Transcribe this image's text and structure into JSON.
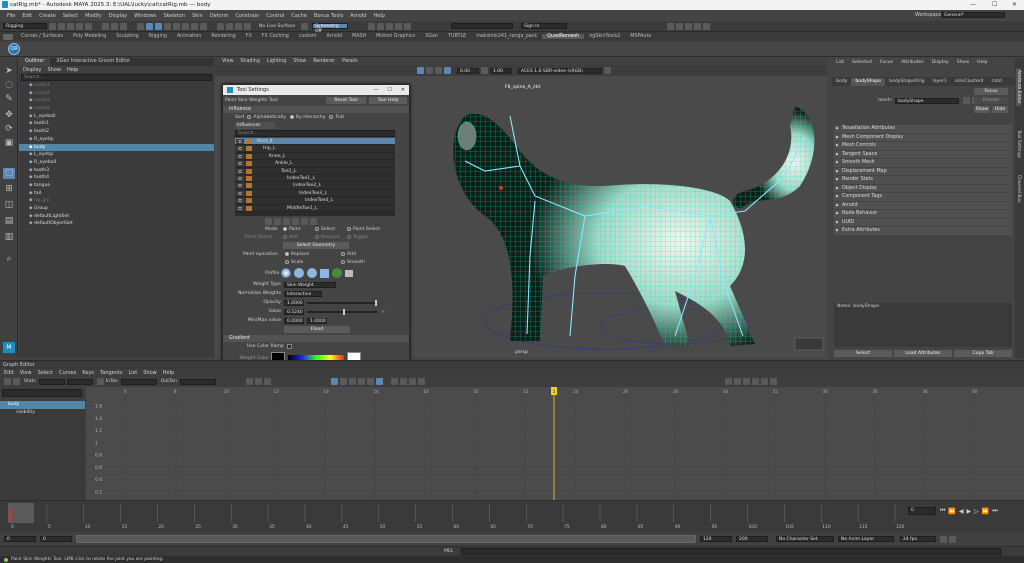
{
  "window": {
    "title": "catRig.mb* - Autodesk MAYA 2025.3: E:\\UAL\\lucky\\cat\\catRig.mb   ---   body",
    "workspace_label": "Workspace :",
    "workspace_value": "General*"
  },
  "menus": [
    "File",
    "Edit",
    "Create",
    "Select",
    "Modify",
    "Display",
    "Windows",
    "Skeleton",
    "Skin",
    "Deform",
    "Constrain",
    "Control",
    "Cache",
    "Bonus Tools",
    "Arnold",
    "Help"
  ],
  "status_line": {
    "mode": "Rigging",
    "live_surface": "No Live Surface",
    "symmetry": "Symmetry: Off",
    "sign_in": "Sign In"
  },
  "shelf_tabs": [
    "Curves / Surfaces",
    "Poly Modeling",
    "Sculpting",
    "Rigging",
    "Animation",
    "Rendering",
    "FX",
    "FX Caching",
    "custom",
    "Arnold",
    "MASH",
    "Motion Graphics",
    "XGen",
    "TURTLE",
    "maksimk241_ranga_pack",
    "QuadRemesh",
    "ngSkinTools2",
    "MSPAuto"
  ],
  "shelf_active": "QuadRemesh",
  "outliner": {
    "tabs": [
      "Outliner",
      "XGen Interactive Groom Editor"
    ],
    "menu": [
      "Display",
      "Show",
      "Help"
    ],
    "search_placeholder": "Search...",
    "items": [
      {
        "name": "nurbs1",
        "style": "dim"
      },
      {
        "name": "nurbs2",
        "style": "dim"
      },
      {
        "name": "nurbs3",
        "style": "dim"
      },
      {
        "name": "nurbs4",
        "style": "dim"
      },
      {
        "name": "L_eyeball",
        "style": ""
      },
      {
        "name": "tooth1",
        "style": ""
      },
      {
        "name": "tooth2",
        "style": ""
      },
      {
        "name": "R_eyetip",
        "style": ""
      },
      {
        "name": "body",
        "style": "sel"
      },
      {
        "name": "L_eyetip",
        "style": ""
      },
      {
        "name": "R_eyeball",
        "style": ""
      },
      {
        "name": "tooth3",
        "style": ""
      },
      {
        "name": "tooth4",
        "style": ""
      },
      {
        "name": "tongue",
        "style": ""
      },
      {
        "name": "tail",
        "style": ""
      },
      {
        "name": "rig_grp",
        "style": "dim"
      },
      {
        "name": "Group",
        "style": ""
      },
      {
        "name": "defaultLightSet",
        "style": ""
      },
      {
        "name": "defaultObjectSet",
        "style": ""
      }
    ]
  },
  "viewport": {
    "menu": [
      "View",
      "Shading",
      "Lighting",
      "Show",
      "Renderer",
      "Panels"
    ],
    "field_a": "0.00",
    "field_b": "1.00",
    "colorspace": "ACES 1.0 SDR-video (sRGB)",
    "cam_label": "persp",
    "joint_label": "FK_spine_A_ctrl"
  },
  "tool_settings": {
    "window_title": "Tool Settings",
    "tool_name": "Paint Skin Weights Tool",
    "reset_label": "Reset Tool",
    "help_label": "Tool Help",
    "section_influence": "Influence",
    "sort_label": "Sort",
    "sort_options": [
      "Alphabetically",
      "By Hierarchy",
      "Flat"
    ],
    "influences_label": "Influences",
    "search_placeholder": "Search...",
    "joints": [
      {
        "name": "Root_Jt",
        "indent": 0,
        "sel": true
      },
      {
        "name": "Hip_L",
        "indent": 1,
        "sel": false
      },
      {
        "name": "Knee_L",
        "indent": 2,
        "sel": false
      },
      {
        "name": "Ankle_L",
        "indent": 3,
        "sel": false
      },
      {
        "name": "Toe1_L",
        "indent": 4,
        "sel": false
      },
      {
        "name": "IndexToe1_L",
        "indent": 5,
        "sel": false
      },
      {
        "name": "IndexToe2_L",
        "indent": 6,
        "sel": false
      },
      {
        "name": "IndexToe3_L",
        "indent": 7,
        "sel": false
      },
      {
        "name": "IndexToe4_L",
        "indent": 8,
        "sel": false
      },
      {
        "name": "MiddleToe1_L",
        "indent": 5,
        "sel": false
      }
    ],
    "mode_label": "Mode",
    "mode_options": [
      "Paint",
      "Select",
      "Paint Select"
    ],
    "paint_select_label": "Paint Select",
    "paint_select_options": [
      "Add",
      "Remove",
      "Toggle"
    ],
    "select_geometry": "Select Geometry",
    "paint_op_label": "Paint operation",
    "paint_ops": [
      "Replace",
      "Add",
      "Scale",
      "Smooth"
    ],
    "profile_label": "Profile",
    "weight_type_label": "Weight Type",
    "weight_type_value": "Skin Weight",
    "normalize_label": "Normalize Weights",
    "normalize_value": "Interactive",
    "opacity_label": "Opacity",
    "opacity_value": "1.0000",
    "value_label": "Value",
    "value_value": "0.5240",
    "minmax_label": "Min/Max value",
    "min_value": "0.0000",
    "max_value": "1.0000",
    "flood_label": "Flood",
    "section_gradient": "Gradient",
    "use_color_ramp": "Use Color Ramp",
    "weight_color_label": "Weight Color",
    "selected_color_label": "Selected Color",
    "color_presets_label": "Color presets",
    "section_stroke": "Stroke",
    "section_stylus": "Stylus Pressure",
    "section_display": "Display"
  },
  "attribute_editor": {
    "menu": [
      "List",
      "Selected",
      "Focus",
      "Attributes",
      "Display",
      "Show",
      "Help"
    ],
    "tabs": [
      "body",
      "bodyShape",
      "bodyShapeOrig",
      "layer1",
      "skinCluster4",
      "catcl"
    ],
    "active_tab": "bodyShape",
    "mesh_label": "mesh:",
    "mesh_value": "bodyShape",
    "focus_label": "Focus",
    "presets_label": "Presets",
    "show_label": "Show",
    "hide_label": "Hide",
    "sections": [
      "Tessellation Attributes",
      "Mesh Component Display",
      "Mesh Controls",
      "Tangent Space",
      "Smooth Mesh",
      "Displacement Map",
      "Render Stats",
      "Object Display",
      "Component Tags",
      "Arnold",
      "Node Behavior",
      "UUID",
      "Extra Attributes"
    ],
    "notes_label": "Notes:  bodyShape",
    "select_btn": "Select",
    "load_btn": "Load Attributes",
    "copy_btn": "Copy Tab"
  },
  "right_strip_labels": [
    "Attribute Editor",
    "Tool Settings",
    "Channel Box"
  ],
  "graph_editor": {
    "title": "Graph Editor",
    "menu": [
      "Edit",
      "View",
      "Select",
      "Curves",
      "Keys",
      "Tangents",
      "List",
      "Show",
      "Help"
    ],
    "stats_label": "Stats",
    "in_tan_label": "InTan",
    "out_tan_label": "OutTan",
    "outline_items": [
      "body",
      "visibility"
    ],
    "y_ticks": [
      "1.6",
      "1.4",
      "1.2",
      "1",
      "0.8",
      "0.6",
      "0.4",
      "0.2"
    ],
    "x_ticks": [
      "6",
      "8",
      "10",
      "12",
      "14",
      "16",
      "18",
      "20",
      "22",
      "24",
      "26",
      "28",
      "30",
      "32",
      "34",
      "36",
      "38",
      "40"
    ],
    "current_frame": "1"
  },
  "time_slider": {
    "ticks": [
      "0",
      "5",
      "10",
      "15",
      "20",
      "25",
      "30",
      "35",
      "40",
      "45",
      "50",
      "55",
      "60",
      "65",
      "70",
      "75",
      "80",
      "85",
      "90",
      "95",
      "100",
      "105",
      "110",
      "115",
      "120"
    ],
    "current": "0",
    "start": "0",
    "end_a": "120",
    "end_b": "200",
    "range_start": "0",
    "range_inner": "0",
    "range_end": "120",
    "fps": "24 fps",
    "character_set": "No Character Set",
    "anim_layer": "No Anim Layer"
  },
  "command_line": {
    "lang": "MEL"
  },
  "help_line": "Paint Skin Weights Tool: LMB click to rotate the joint you are painting."
}
